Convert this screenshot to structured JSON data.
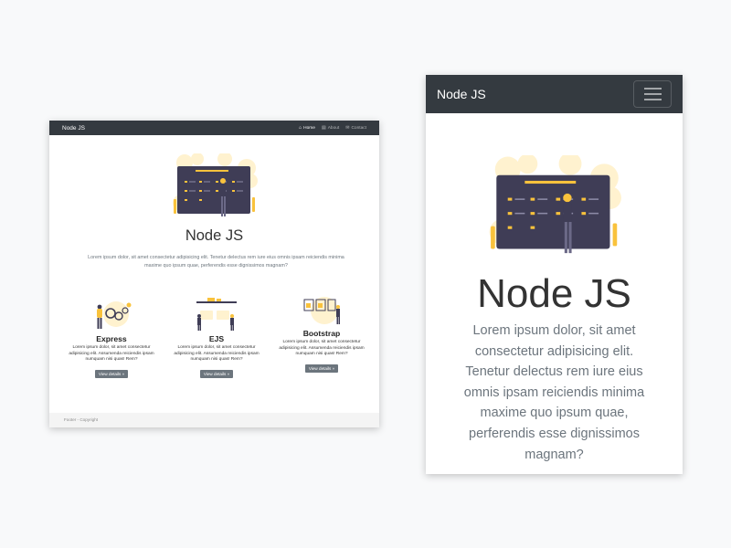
{
  "desktop": {
    "nav": {
      "brand": "Node JS",
      "links": [
        {
          "label": "Home",
          "icon": "home-icon",
          "active": true
        },
        {
          "label": "About",
          "icon": "document-icon",
          "active": false
        },
        {
          "label": "Contact",
          "icon": "envelope-icon",
          "active": false
        }
      ]
    },
    "hero": {
      "title": "Node JS",
      "text": "Lorem ipsum dolor, sit amet consectetur adipisicing elit. Tenetur delectus rem iure eius omnis ipsam reiciendis minima maxime quo ipsum quae, perferendis esse dignissimos magnam?"
    },
    "features": [
      {
        "title": "Express",
        "text": "Lorem ipsum dolor, sit amet consectetur adipisicing elit. Assumenda reiciendis ipsam numquam nisi quas! Rem?",
        "button": "View details »"
      },
      {
        "title": "EJS",
        "text": "Lorem ipsum dolor, sit amet consectetur adipisicing elit. Assumenda reiciendis ipsam numquam nisi quas! Rem?",
        "button": "View details »"
      },
      {
        "title": "Bootstrap",
        "text": "Lorem ipsum dolor, sit amet consectetur adipisicing elit. Assumenda reiciendis ipsam numquam nisi quas! Rem?",
        "button": "View details »"
      }
    ],
    "footer": "Footer - Copyright"
  },
  "mobile": {
    "nav": {
      "brand": "Node JS"
    },
    "hero": {
      "title": "Node JS",
      "text": "Lorem ipsum dolor, sit amet consectetur adipisicing elit. Tenetur delectus rem iure eius omnis ipsam reiciendis minima maxime quo ipsum quae, perferendis esse dignissimos magnam?"
    }
  },
  "colors": {
    "navbar": "#343a40",
    "accent": "#f9c23c",
    "board": "#3f3d56",
    "button": "#6c757d",
    "page_background": "#f8f9fa"
  }
}
